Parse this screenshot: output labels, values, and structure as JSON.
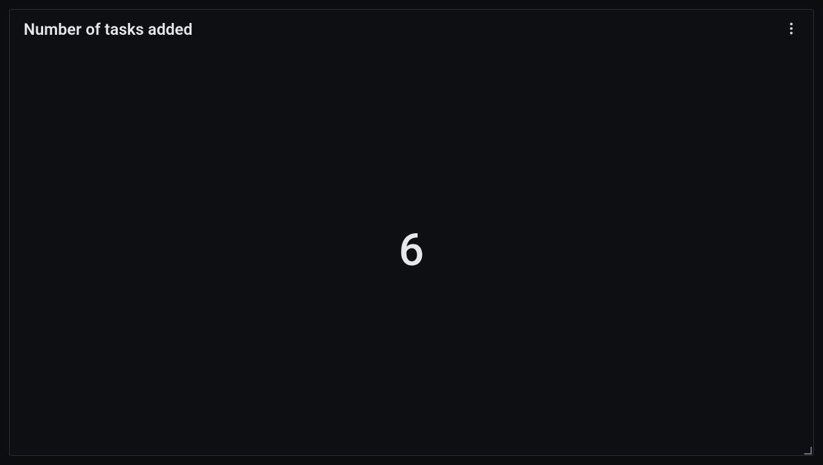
{
  "panel": {
    "title": "Number of tasks added",
    "value": "6"
  }
}
